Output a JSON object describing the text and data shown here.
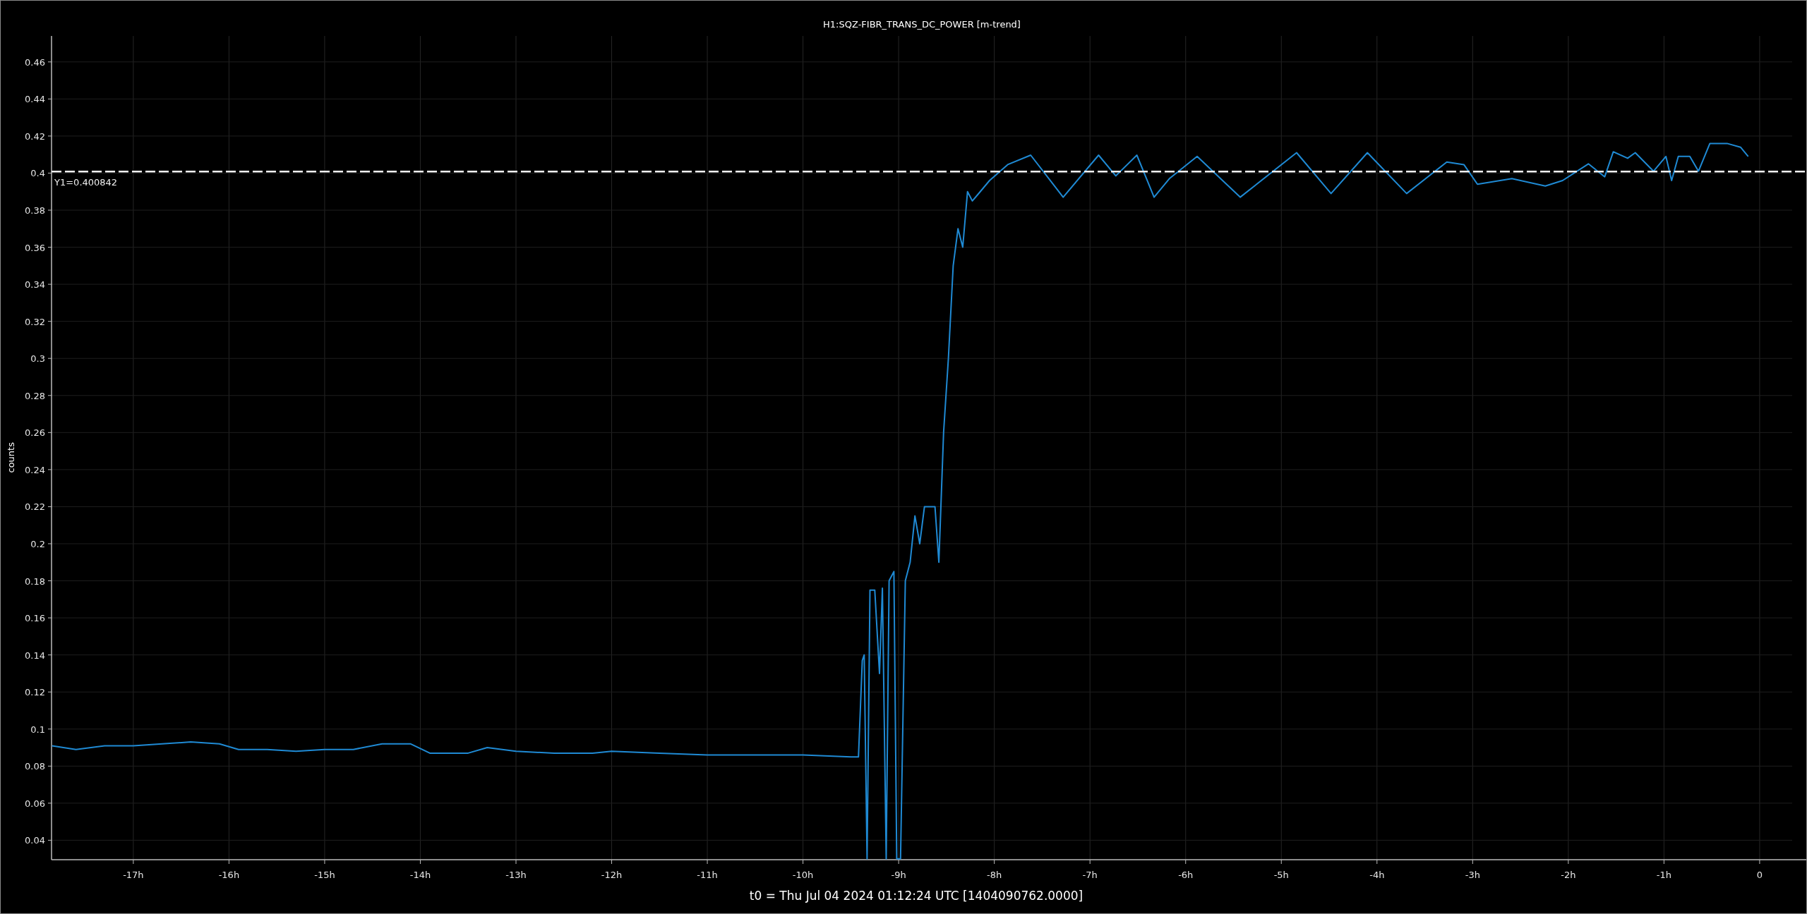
{
  "plot": {
    "chart_data": {
      "type": "line",
      "title": "H1:SQZ-FIBR_TRANS_DC_POWER [m-trend]",
      "ylabel": "counts",
      "x": [
        -17.85,
        -17.6,
        -17.3,
        -17,
        -16.7,
        -16.4,
        -16.1,
        -15.9,
        -15.6,
        -15.3,
        -15,
        -14.7,
        -14.4,
        -14.1,
        -13.9,
        -13.5,
        -13.3,
        -13,
        -12.6,
        -12.2,
        -12,
        -11.5,
        -11,
        -10.5,
        -10,
        -9.5,
        -9.42,
        -9.38,
        -9.36,
        -9.33,
        -9.3,
        -9.25,
        -9.2,
        -9.17,
        -9.13,
        -9.1,
        -9.05,
        -9.02,
        -8.98,
        -8.93,
        -8.88,
        -8.83,
        -8.78,
        -8.73,
        -8.68,
        -8.62,
        -8.58,
        -8.53,
        -8.48,
        -8.43,
        -8.38,
        -8.33,
        -8.28,
        -8.23,
        -8.18,
        -8.05,
        -7.86,
        -7.62,
        -7.28,
        -6.91,
        -6.73,
        -6.51,
        -6.33,
        -6.17,
        -5.88,
        -5.43,
        -4.84,
        -4.48,
        -4.1,
        -3.69,
        -3.27,
        -3.09,
        -2.95,
        -2.59,
        -2.24,
        -2.06,
        -1.79,
        -1.62,
        -1.53,
        -1.38,
        -1.3,
        -1.11,
        -0.98,
        -0.92,
        -0.85,
        -0.73,
        -0.64,
        -0.52,
        -0.34,
        -0.2,
        -0.12
      ],
      "series": [
        {
          "color": "#1f8ad4",
          "values": [
            0.091,
            0.089,
            0.091,
            0.091,
            0.092,
            0.093,
            0.092,
            0.089,
            0.089,
            0.088,
            0.089,
            0.089,
            0.092,
            0.092,
            0.087,
            0.087,
            0.09,
            0.088,
            0.087,
            0.087,
            0.088,
            0.087,
            0.086,
            0.086,
            0.086,
            0.085,
            0.085,
            0.137,
            0.14,
            0.03,
            0.175,
            0.175,
            0.13,
            0.176,
            0.03,
            0.18,
            0.185,
            0.03,
            0.03,
            0.18,
            0.19,
            0.215,
            0.2,
            0.22,
            0.22,
            0.22,
            0.19,
            0.26,
            0.3,
            0.35,
            0.37,
            0.36,
            0.39,
            0.385,
            0.388,
            0.396,
            0.4046,
            0.4097,
            0.387,
            0.4097,
            0.3985,
            0.4097,
            0.387,
            0.397,
            0.409,
            0.387,
            0.411,
            0.389,
            0.411,
            0.389,
            0.406,
            0.4045,
            0.394,
            0.397,
            0.393,
            0.396,
            0.405,
            0.398,
            0.4115,
            0.408,
            0.411,
            0.401,
            0.409,
            0.396,
            0.409,
            0.409,
            0.401,
            0.416,
            0.416,
            0.414,
            0.409
          ]
        }
      ],
      "xlim": [
        -17.855,
        0.34
      ],
      "ylim": [
        0.0295,
        0.474
      ],
      "xticks": [
        {
          "value": -17,
          "label": "-17h"
        },
        {
          "value": -16,
          "label": "-16h"
        },
        {
          "value": -15,
          "label": "-15h"
        },
        {
          "value": -14,
          "label": "-14h"
        },
        {
          "value": -13,
          "label": "-13h"
        },
        {
          "value": -12,
          "label": "-12h"
        },
        {
          "value": -11,
          "label": "-11h"
        },
        {
          "value": -10,
          "label": "-10h"
        },
        {
          "value": -9,
          "label": "-9h"
        },
        {
          "value": -8,
          "label": "-8h"
        },
        {
          "value": -7,
          "label": "-7h"
        },
        {
          "value": -6,
          "label": "-6h"
        },
        {
          "value": -5,
          "label": "-5h"
        },
        {
          "value": -4,
          "label": "-4h"
        },
        {
          "value": -3,
          "label": "-3h"
        },
        {
          "value": -2,
          "label": "-2h"
        },
        {
          "value": -1,
          "label": "-1h"
        },
        {
          "value": 0,
          "label": "0"
        }
      ],
      "yticks": [
        0.04,
        0.06,
        0.08,
        0.1,
        0.12,
        0.14,
        0.16,
        0.18,
        0.2,
        0.22,
        0.24,
        0.26,
        0.28,
        0.3,
        0.32,
        0.34,
        0.36,
        0.38,
        0.4,
        0.42,
        0.44,
        0.46
      ],
      "grid": true,
      "ref_lines": [
        {
          "axis": "y",
          "value": 0.400842,
          "label": "Y1=0.400842"
        }
      ]
    },
    "time_axis_label": "t0 = Thu Jul 04 2024 01:12:24 UTC [1404090762.0000]"
  }
}
